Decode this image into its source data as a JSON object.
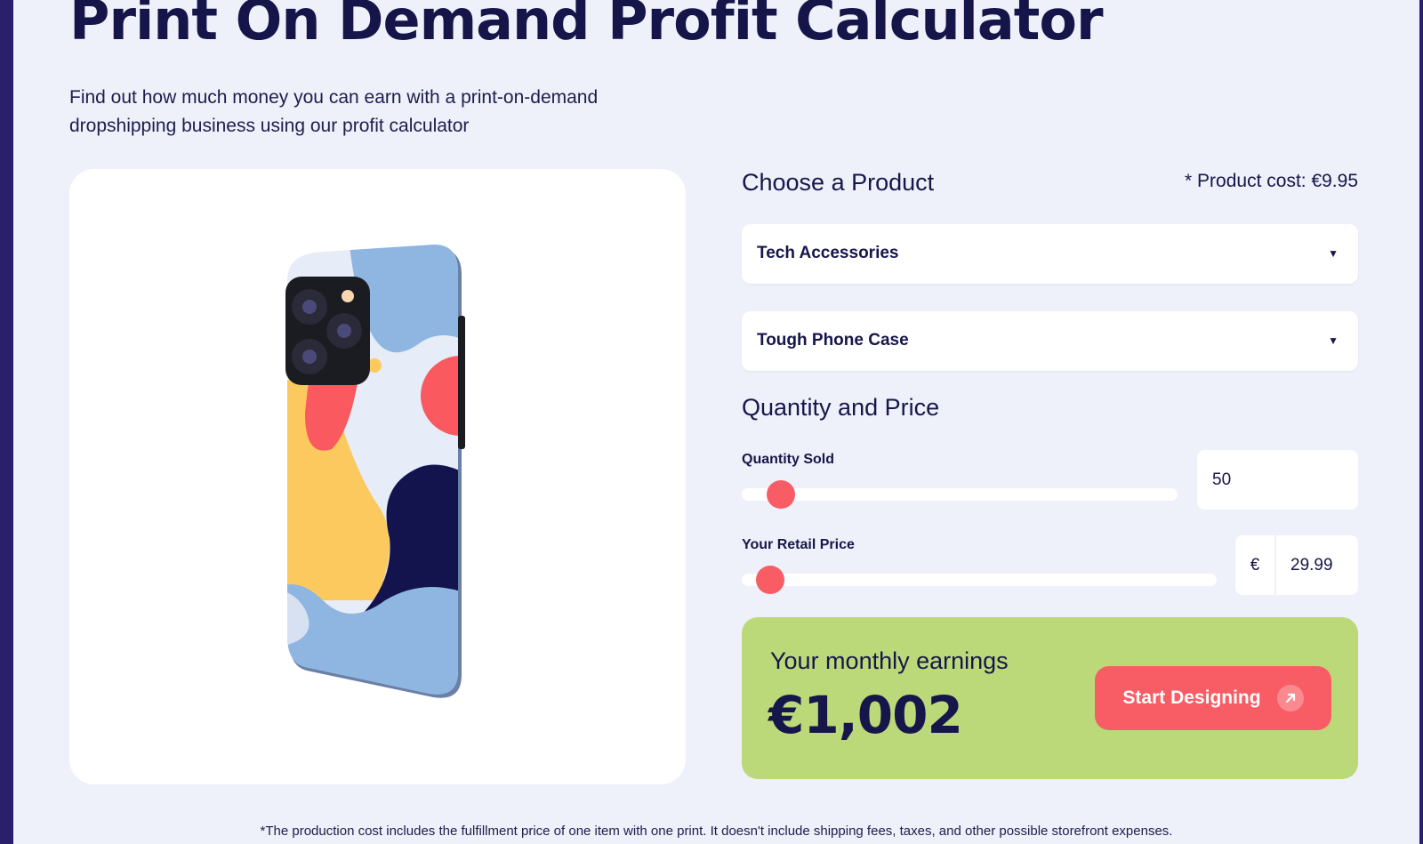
{
  "header": {
    "title": "Print On Demand Profit Calculator",
    "subtitle": "Find out how much money you can earn with a print-on-demand dropshipping business using our profit calculator"
  },
  "product": {
    "heading": "Choose a Product",
    "cost_note": "* Product cost: €9.95",
    "category_select": "Tech Accessories",
    "product_select": "Tough Phone Case"
  },
  "quantity_price": {
    "heading": "Quantity and Price",
    "quantity_label": "Quantity Sold",
    "quantity_value": "50",
    "quantity_slider_fraction": 0.09,
    "price_label": "Your Retail Price",
    "currency_symbol": "€",
    "price_value": "29.99",
    "price_slider_fraction": 0.06
  },
  "earnings": {
    "label": "Your monthly earnings",
    "amount": "€1,002",
    "cta_label": "Start Designing"
  },
  "footnote": "*The production cost includes the fulfillment price of one item with one print. It doesn't include shipping fees, taxes, and other possible storefront expenses.",
  "colors": {
    "accent": "#f85d66",
    "earnings_bg": "#bcd97a",
    "page_bg": "#eef1f9",
    "text": "#16164a"
  }
}
